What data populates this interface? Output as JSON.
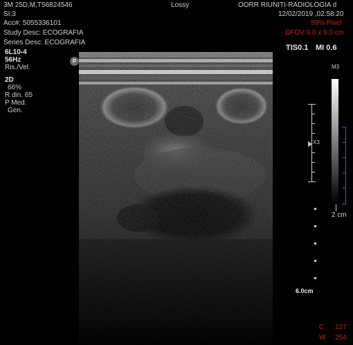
{
  "header": {
    "patient": "3M 25D,M,T56824546",
    "compression": "Lossy",
    "institution": "OORR RIUNITI-RADIOLOGIA d",
    "series": "SI:3",
    "datetime": "12/02/2019 ,02:58:20",
    "accession": "Acc#: 5055336101",
    "pixel_info": "59% Pixel",
    "study_desc": "Study Desc: ECOGRAFIA",
    "dfov": "DFOV 9.0 x 9.0 cm",
    "series_desc": "Series Desc: ECOGRAFIA"
  },
  "left_panel": {
    "probe": "6L10-4",
    "frame_rate": "56Hz",
    "mode_label": "Ris./Vel.",
    "mode": "2D",
    "gain": "66%",
    "dynamic_range": "R din. 65",
    "preset": "P Med.",
    "gen": "Gen."
  },
  "indices": {
    "tis": "TIS0.1",
    "mi": "MI 0.6"
  },
  "right_panel": {
    "map": "M3",
    "zoom": "X3",
    "scale_label": "2 cm",
    "depth": "6.0cm"
  },
  "window": {
    "center_label": "C",
    "center_value": "127",
    "width_label": "W",
    "width_value": "254"
  },
  "probe_marker": "P",
  "colors": {
    "text": "#d0d0d0",
    "accent_red": "#d01c1c",
    "scale_blue": "#1f6fd6"
  }
}
